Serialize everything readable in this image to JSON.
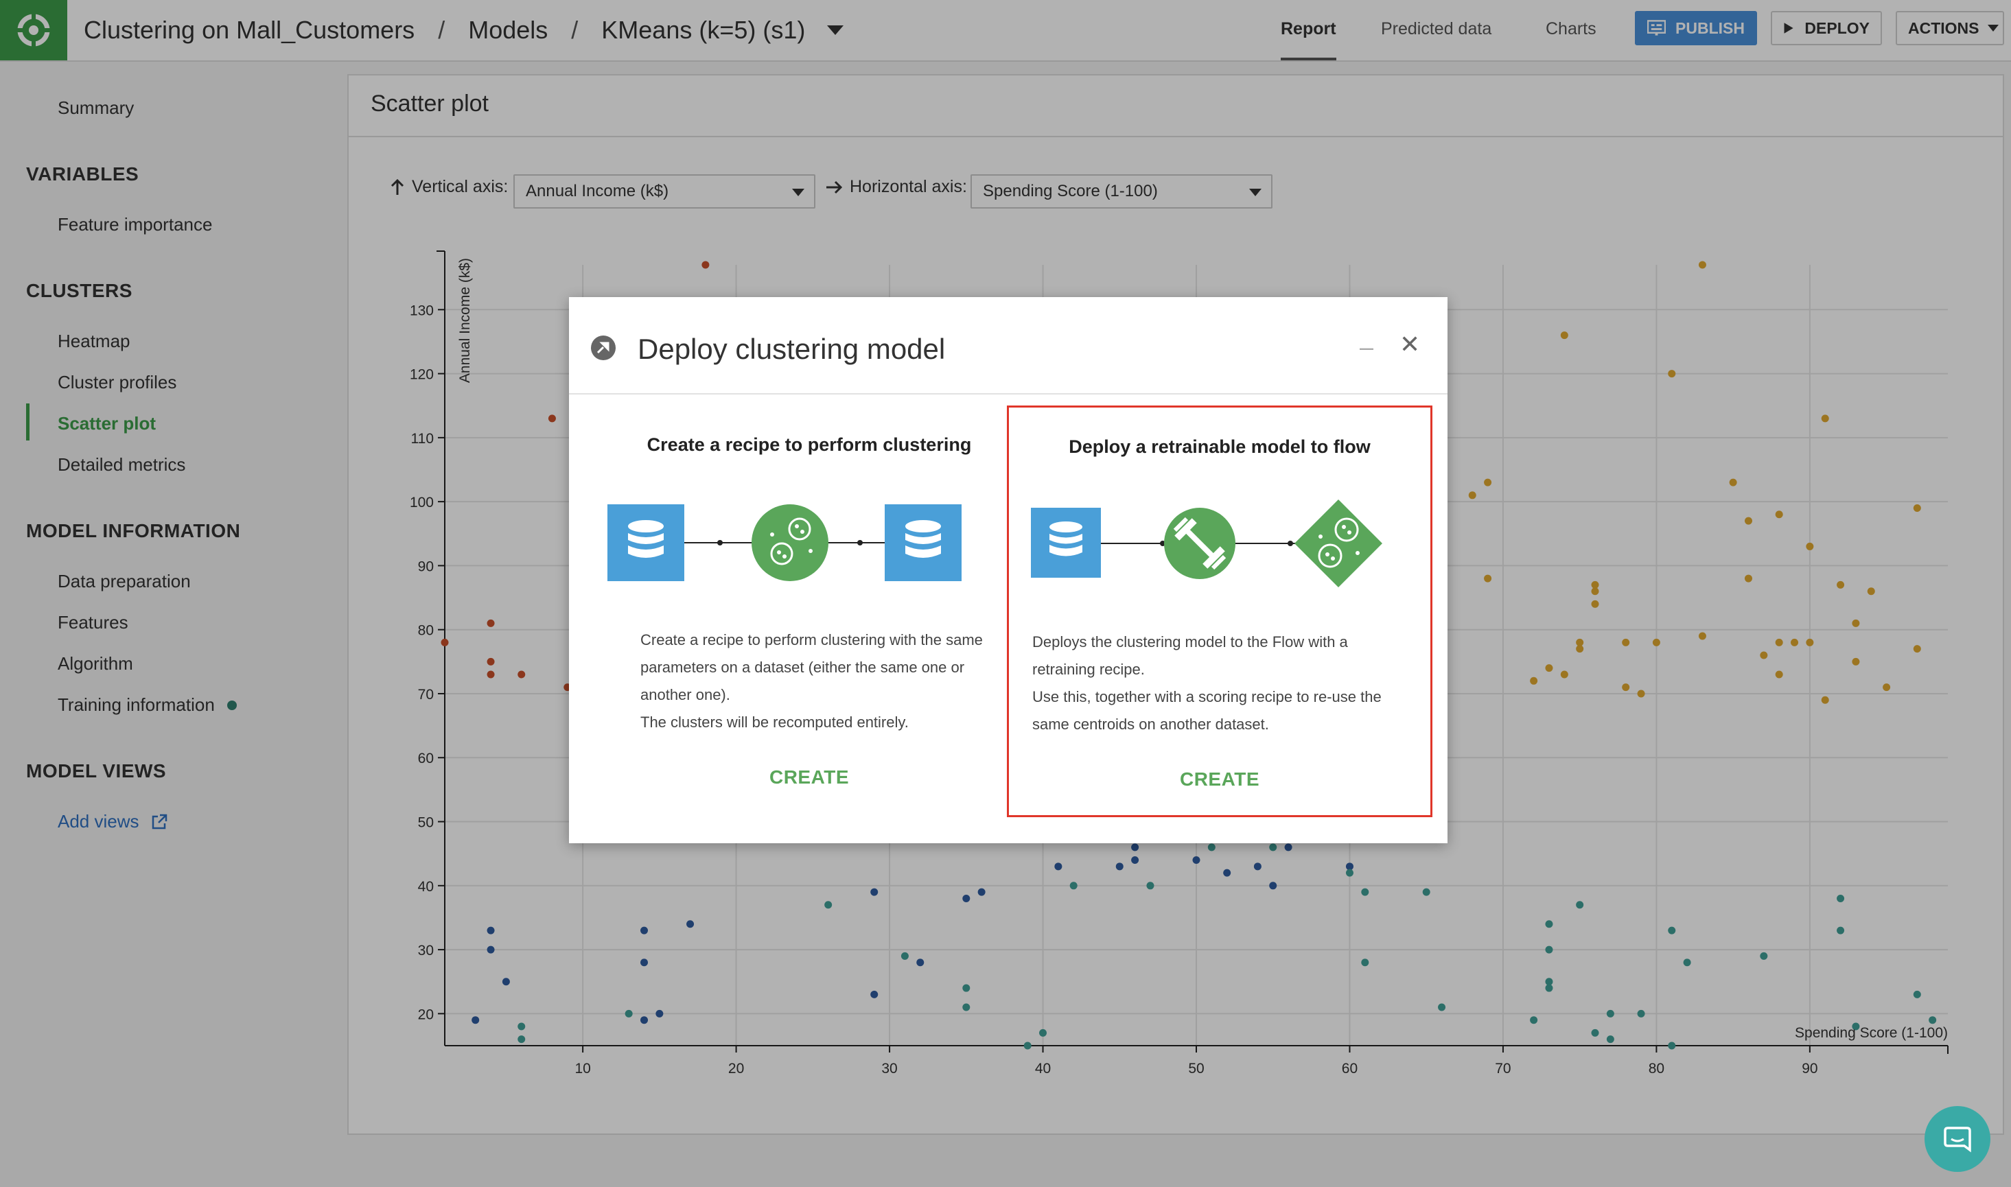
{
  "header": {
    "breadcrumbs": [
      "Clustering on Mall_Customers",
      "Models",
      "KMeans (k=5) (s1)"
    ],
    "separator": "/",
    "tabs": [
      "Report",
      "Predicted data",
      "Charts"
    ],
    "active_tab": "Report",
    "publish_label": "PUBLISH",
    "deploy_label": "DEPLOY",
    "actions_label": "ACTIONS"
  },
  "sidebar": {
    "summary": "Summary",
    "sections": [
      {
        "title": "VARIABLES",
        "items": [
          "Feature importance"
        ]
      },
      {
        "title": "CLUSTERS",
        "items": [
          "Heatmap",
          "Cluster profiles",
          "Scatter plot",
          "Detailed metrics"
        ]
      },
      {
        "title": "MODEL INFORMATION",
        "items": [
          "Data preparation",
          "Features",
          "Algorithm",
          "Training information"
        ]
      },
      {
        "title": "MODEL VIEWS",
        "items": [
          "Add views"
        ]
      }
    ],
    "active_item": "Scatter plot"
  },
  "panel": {
    "title": "Scatter plot",
    "vertical_axis_label": "Vertical axis:",
    "vertical_axis_value": "Annual Income (k$)",
    "horizontal_axis_label": "Horizontal axis:",
    "horizontal_axis_value": "Spending Score (1-100)"
  },
  "chart_data": {
    "type": "scatter",
    "xlabel": "Spending Score (1-100)",
    "ylabel": "Annual Income (k$)",
    "xlim": [
      1,
      99
    ],
    "ylim": [
      15,
      137
    ],
    "xticks": [
      10,
      20,
      30,
      40,
      50,
      60,
      70,
      80,
      90
    ],
    "yticks": [
      20,
      30,
      40,
      50,
      60,
      70,
      80,
      90,
      100,
      110,
      120,
      130
    ],
    "grid": true,
    "series": [
      {
        "color": "#c8502a",
        "points": [
          [
            1,
            78
          ],
          [
            4,
            81
          ],
          [
            4,
            75
          ],
          [
            4,
            73
          ],
          [
            6,
            73
          ],
          [
            8,
            113
          ],
          [
            9,
            71
          ],
          [
            18,
            137
          ]
        ]
      },
      {
        "color": "#2f5b9e",
        "points": [
          [
            3,
            19
          ],
          [
            4,
            33
          ],
          [
            4,
            30
          ],
          [
            5,
            25
          ],
          [
            14,
            33
          ],
          [
            14,
            28
          ],
          [
            14,
            19
          ],
          [
            15,
            20
          ],
          [
            17,
            34
          ],
          [
            29,
            23
          ],
          [
            29,
            39
          ],
          [
            32,
            28
          ],
          [
            35,
            38
          ],
          [
            36,
            39
          ],
          [
            41,
            43
          ],
          [
            45,
            43
          ],
          [
            46,
            44
          ],
          [
            46,
            46
          ],
          [
            50,
            44
          ],
          [
            52,
            42
          ],
          [
            54,
            43
          ],
          [
            55,
            40
          ],
          [
            56,
            46
          ],
          [
            60,
            43
          ]
        ]
      },
      {
        "color": "#3f9e96",
        "points": [
          [
            6,
            18
          ],
          [
            6,
            16
          ],
          [
            13,
            20
          ],
          [
            26,
            37
          ],
          [
            31,
            29
          ],
          [
            35,
            24
          ],
          [
            35,
            21
          ],
          [
            39,
            15
          ],
          [
            40,
            17
          ],
          [
            42,
            40
          ],
          [
            47,
            40
          ],
          [
            51,
            46
          ],
          [
            55,
            46
          ],
          [
            60,
            42
          ],
          [
            61,
            39
          ],
          [
            61,
            28
          ],
          [
            65,
            39
          ],
          [
            66,
            21
          ],
          [
            72,
            19
          ],
          [
            73,
            34
          ],
          [
            73,
            30
          ],
          [
            73,
            25
          ],
          [
            73,
            24
          ],
          [
            75,
            37
          ],
          [
            76,
            17
          ],
          [
            77,
            16
          ],
          [
            77,
            20
          ],
          [
            79,
            20
          ],
          [
            81,
            33
          ],
          [
            81,
            15
          ],
          [
            82,
            28
          ],
          [
            87,
            29
          ],
          [
            92,
            38
          ],
          [
            92,
            33
          ],
          [
            93,
            18
          ],
          [
            97,
            23
          ],
          [
            98,
            19
          ]
        ]
      },
      {
        "color": "#e0a830",
        "points": [
          [
            68,
            101
          ],
          [
            69,
            103
          ],
          [
            69,
            88
          ],
          [
            72,
            72
          ],
          [
            73,
            74
          ],
          [
            74,
            73
          ],
          [
            75,
            78
          ],
          [
            74,
            126
          ],
          [
            75,
            77
          ],
          [
            76,
            84
          ],
          [
            76,
            86
          ],
          [
            76,
            87
          ],
          [
            78,
            78
          ],
          [
            78,
            71
          ],
          [
            79,
            70
          ],
          [
            80,
            78
          ],
          [
            81,
            120
          ],
          [
            83,
            137
          ],
          [
            83,
            79
          ],
          [
            85,
            103
          ],
          [
            86,
            88
          ],
          [
            86,
            97
          ],
          [
            87,
            76
          ],
          [
            88,
            78
          ],
          [
            88,
            98
          ],
          [
            88,
            73
          ],
          [
            89,
            78
          ],
          [
            90,
            78
          ],
          [
            90,
            93
          ],
          [
            91,
            113
          ],
          [
            91,
            69
          ],
          [
            92,
            87
          ],
          [
            93,
            81
          ],
          [
            93,
            75
          ],
          [
            94,
            86
          ],
          [
            95,
            71
          ],
          [
            97,
            99
          ],
          [
            97,
            77
          ]
        ]
      }
    ]
  },
  "modal": {
    "title": "Deploy clustering model",
    "left": {
      "title": "Create a recipe to perform clustering",
      "desc_lines": [
        "Create a recipe to perform clustering with the same",
        "parameters on a dataset (either the same one or",
        "another one).",
        "The clusters will be recomputed entirely."
      ],
      "create_label": "CREATE"
    },
    "right": {
      "title": "Deploy a retrainable model to flow",
      "desc_lines": [
        "Deploys the clustering model to the Flow with a",
        "retraining recipe.",
        "Use this, together with a scoring recipe to re-use the",
        "same centroids on another dataset."
      ],
      "create_label": "CREATE"
    }
  },
  "colors": {
    "brand_green": "#3d9b4a",
    "dataset_blue": "#4a9fd8",
    "highlight_red": "#e0362a",
    "publish_blue": "#4a90d9"
  }
}
